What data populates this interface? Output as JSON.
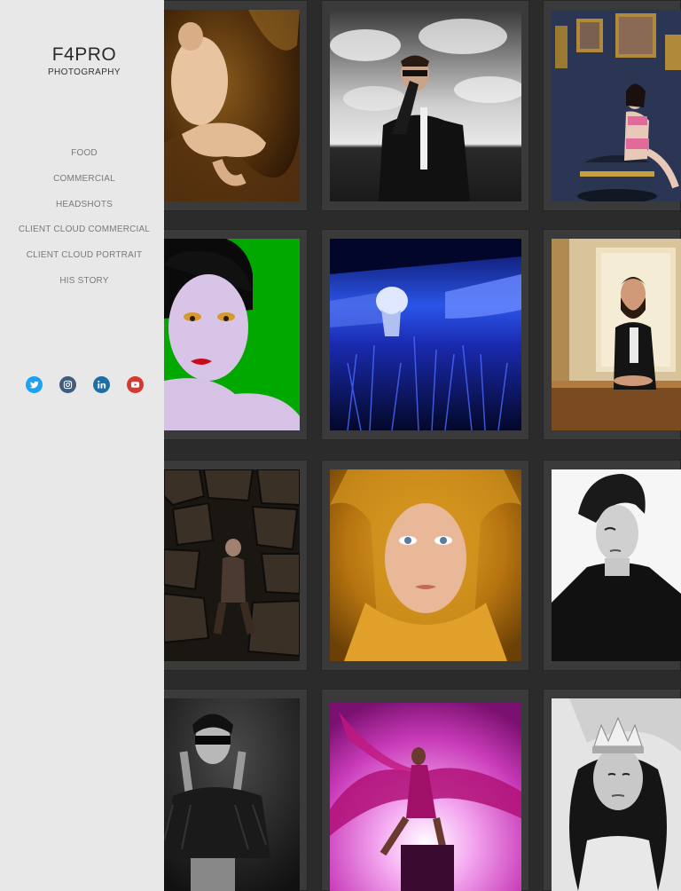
{
  "brand": {
    "name": "F4PRO",
    "subtitle": "PHOTOGRAPHY"
  },
  "nav": {
    "items": [
      {
        "label": "FOOD"
      },
      {
        "label": "COMMERCIAL"
      },
      {
        "label": "HEADSHOTS"
      },
      {
        "label": "CLIENT CLOUD COMMERCIAL"
      },
      {
        "label": "CLIENT CLOUD PORTRAIT"
      },
      {
        "label": "HIS STORY"
      }
    ]
  },
  "social": [
    {
      "icon": "twitter-icon",
      "color": "#1da1f2"
    },
    {
      "icon": "instagram-icon",
      "color": "#3f5b7e"
    },
    {
      "icon": "linkedin-icon",
      "color": "#1d6fa5"
    },
    {
      "icon": "youtube-icon",
      "color": "#d63a2f"
    }
  ],
  "colors": {
    "sidebar_bg": "#e8e8e8",
    "gallery_bg": "#2b2b2b",
    "nav_text": "#7a7a7a"
  },
  "gallery": {
    "photos": [
      {
        "name": "photo-pregnant-woman-gold-fabric"
      },
      {
        "name": "photo-man-suit-sunglasses-sky"
      },
      {
        "name": "photo-woman-pink-lingerie-paintings"
      },
      {
        "name": "photo-woman-purple-skin-green-bg"
      },
      {
        "name": "photo-woman-blue-grass"
      },
      {
        "name": "photo-bearded-man-suit-table"
      },
      {
        "name": "photo-man-rocks-dark"
      },
      {
        "name": "photo-woman-gold-scarf"
      },
      {
        "name": "photo-woman-black-white-profile"
      },
      {
        "name": "photo-woman-blindfold-feathers"
      },
      {
        "name": "photo-dancer-pink-fabric"
      },
      {
        "name": "photo-woman-crown-black-white"
      }
    ]
  }
}
